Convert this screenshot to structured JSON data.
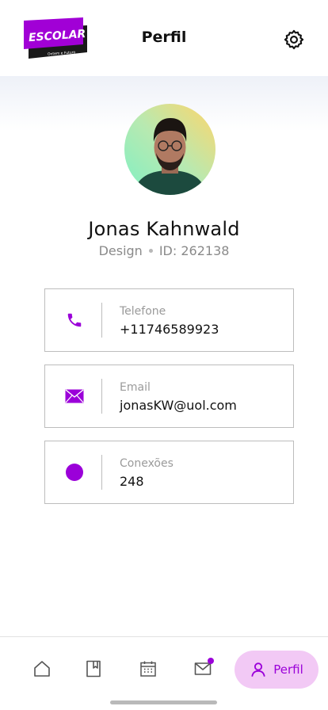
{
  "header": {
    "logo_text": "ESCOLAR",
    "logo_subtext": "Ontem e Futuro",
    "title": "Perfil"
  },
  "profile": {
    "name": "Jonas Kahnwald",
    "department": "Design",
    "id_text": "ID: 262138"
  },
  "info_cards": [
    {
      "icon": "phone-icon",
      "label": "Telefone",
      "value": "+11746589923"
    },
    {
      "icon": "mail-icon",
      "label": "Email",
      "value": "jonasKW@uol.com"
    },
    {
      "icon": "circle-icon",
      "label": "Conexões",
      "value": "248"
    }
  ],
  "bottom_nav": {
    "items": [
      {
        "icon": "home-icon"
      },
      {
        "icon": "bookmark-icon"
      },
      {
        "icon": "calendar-icon"
      },
      {
        "icon": "mail-icon",
        "has_notification": true
      },
      {
        "icon": "user-icon",
        "label": "Perfil",
        "active": true
      }
    ]
  },
  "colors": {
    "accent": "#9b00d9",
    "active_pill": "#f2c9f5",
    "logo_bg": "#a100d6"
  }
}
